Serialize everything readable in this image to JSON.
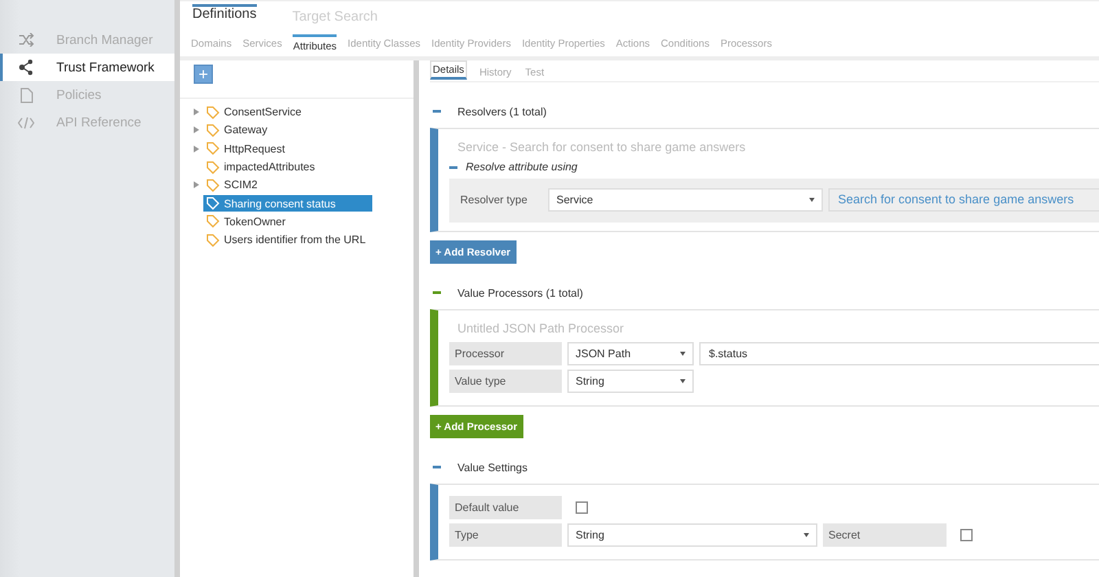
{
  "sidebar": {
    "items": [
      {
        "kind": "shuffle",
        "label": "Branch Manager",
        "selected": false
      },
      {
        "kind": "share",
        "label": "Trust Framework",
        "selected": true
      },
      {
        "kind": "document",
        "label": "Policies",
        "selected": false
      },
      {
        "kind": "code",
        "label": "API Reference",
        "selected": false
      }
    ]
  },
  "top_tabs": [
    {
      "label": "Definitions",
      "selected": true
    },
    {
      "label": "Target Search",
      "selected": false
    }
  ],
  "sub_tabs": [
    {
      "label": "Domains",
      "selected": false
    },
    {
      "label": "Services",
      "selected": false
    },
    {
      "label": "Attributes",
      "selected": true
    },
    {
      "label": "Identity Classes",
      "selected": false
    },
    {
      "label": "Identity Providers",
      "selected": false
    },
    {
      "label": "Identity Properties",
      "selected": false
    },
    {
      "label": "Actions",
      "selected": false
    },
    {
      "label": "Conditions",
      "selected": false
    },
    {
      "label": "Processors",
      "selected": false
    }
  ],
  "tree": {
    "add_button": "+",
    "items": [
      {
        "label": "ConsentService",
        "expandable": true,
        "selected": false
      },
      {
        "label": "Gateway",
        "expandable": true,
        "selected": false
      },
      {
        "label": "HttpRequest",
        "expandable": true,
        "selected": false
      },
      {
        "label": "impactedAttributes",
        "expandable": false,
        "selected": false
      },
      {
        "label": "SCIM2",
        "expandable": true,
        "selected": false
      },
      {
        "label": "Sharing consent status",
        "expandable": false,
        "selected": true
      },
      {
        "label": "TokenOwner",
        "expandable": false,
        "selected": false
      },
      {
        "label": "Users identifier from the URL",
        "expandable": false,
        "selected": false
      }
    ]
  },
  "detail_tabs": [
    {
      "label": "Details",
      "selected": true
    },
    {
      "label": "History",
      "selected": false
    },
    {
      "label": "Test",
      "selected": false
    }
  ],
  "sections": [
    {
      "kind": "resolvers",
      "title": "Resolvers (1 total)",
      "card_title": "Service - Search for consent to share game answers",
      "subheading": "Resolve attribute using",
      "rows": [
        {
          "kind": "select",
          "label": "Resolver type",
          "select": "Service",
          "value": "Search for consent to share game answers"
        }
      ],
      "button": "+ Add Resolver"
    },
    {
      "kind": "processors",
      "title": "Value Processors (1 total)",
      "card_title": "Untitled JSON Path Processor",
      "rows": [
        {
          "kind": "select",
          "label": "Processor",
          "select": "JSON Path",
          "value": "$.status"
        },
        {
          "kind": "select",
          "label": "Value type",
          "select": "String"
        }
      ],
      "button": "+ Add Processor"
    },
    {
      "kind": "settings",
      "title": "Value Settings",
      "rows": [
        {
          "kind": "checkbox",
          "label": "Default value",
          "checked": false
        },
        {
          "kind": "select-check",
          "label": "Type",
          "select": "String",
          "extra_label": "Secret",
          "checked": false
        }
      ]
    }
  ]
}
